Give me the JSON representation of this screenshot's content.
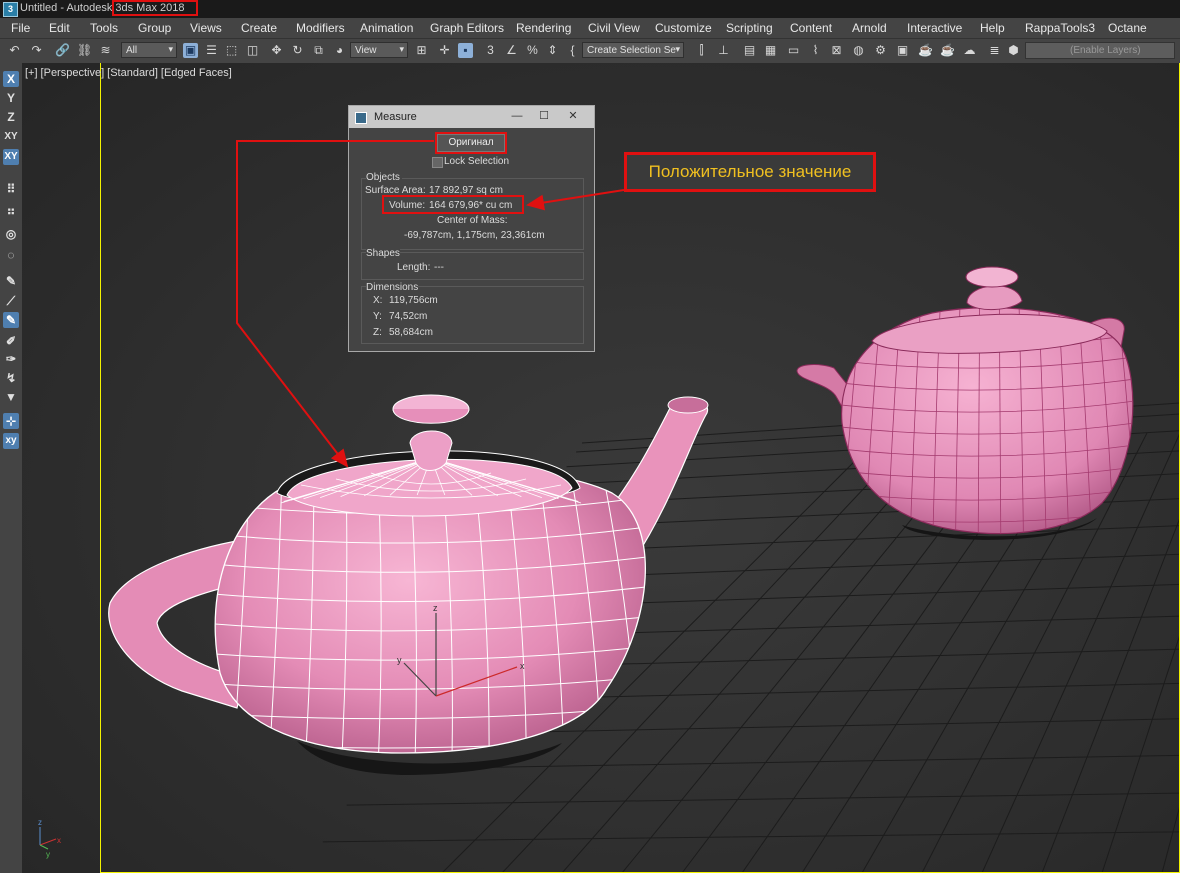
{
  "window": {
    "title": "Untitled - Autodesk 3ds Max 2018",
    "app_icon": "3ds-max-icon"
  },
  "menu": [
    "File",
    "Edit",
    "Tools",
    "Group",
    "Views",
    "Create",
    "Modifiers",
    "Animation",
    "Graph Editors",
    "Rendering",
    "Civil View",
    "Customize",
    "Scripting",
    "Content",
    "Arnold",
    "Interactive",
    "Help",
    "RappaTools3",
    "Octane"
  ],
  "toolbar": {
    "selection_filter": "All",
    "reference_coord": "View",
    "selection_set": "Create Selection Se",
    "layers_placeholder": "(Enable Layers)"
  },
  "left_toolbar": [
    "X",
    "Y",
    "Z",
    "XY",
    "XY"
  ],
  "viewport": {
    "label_plus": "[+]",
    "label_view": "[Perspective]",
    "label_shading": "[Standard]",
    "label_edges": "[Edged Faces]",
    "axis_labels": {
      "x": "x",
      "y": "y",
      "z": "z"
    }
  },
  "measure": {
    "title": "Measure",
    "original_button": "Оригинал",
    "lock_selection": "Lock Selection",
    "objects": {
      "title": "Objects",
      "surface_area_label": "Surface Area:",
      "surface_area_value": "17 892,97 sq cm",
      "volume_label": "Volume:",
      "volume_value": "164 679,96* cu cm",
      "center_label": "Center of Mass:",
      "center_value": "-69,787cm, 1,175cm, 23,361cm"
    },
    "shapes": {
      "title": "Shapes",
      "length_label": "Length:",
      "length_value": "---"
    },
    "dimensions": {
      "title": "Dimensions",
      "x_label": "X:",
      "x_value": "119,756cm",
      "y_label": "Y:",
      "y_value": "74,52cm",
      "z_label": "Z:",
      "z_value": "58,684cm"
    }
  },
  "annotation": {
    "text": "Положительное значение",
    "color": "#e01010"
  },
  "colors": {
    "teapot": "#e890b8",
    "wire": "#ffffff",
    "highlight": "#e01010",
    "viewport_border": "#f2f200"
  }
}
